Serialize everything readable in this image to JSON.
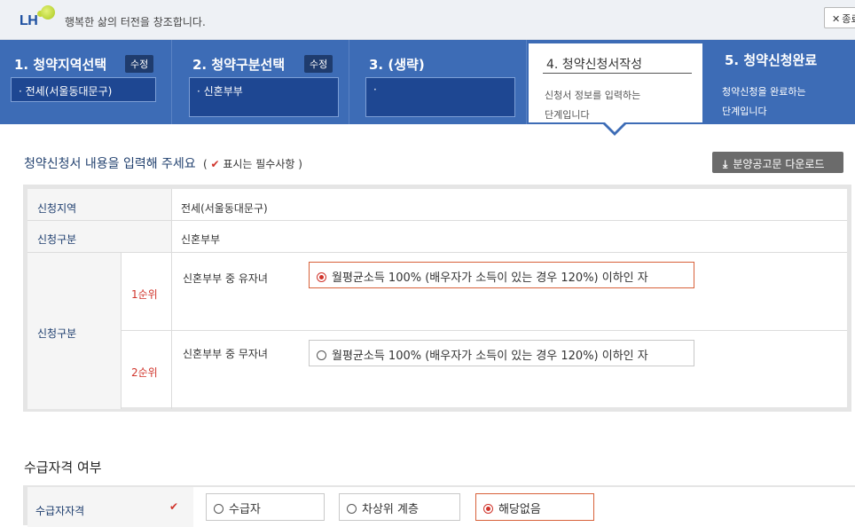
{
  "header": {
    "logo": "LH",
    "slogan": "행복한 삶의 터전을 창조합니다.",
    "close_label": "종료"
  },
  "steps": [
    {
      "title": "1. 청약지역선택",
      "edit": "수정",
      "value": "· 전세(서울동대문구)"
    },
    {
      "title": "2. 청약구분선택",
      "edit": "수정",
      "value": "· 신혼부부"
    },
    {
      "title": "3. (생략)",
      "value": "·"
    },
    {
      "title": "4. 청약신청서작성",
      "desc1": "신청서 정보를 입력하는",
      "desc2": "단계입니다"
    },
    {
      "title": "5. 청약신청완료",
      "desc1": "청약신청을 완료하는",
      "desc2": "단계입니다"
    }
  ],
  "form": {
    "heading": "청약신청서 내용을 입력해 주세요",
    "required_note": "표시는 필수사항",
    "download_label": "분양공고문 다운로드",
    "region_label": "신청지역",
    "region_value": "전세(서울동대문구)",
    "type_label": "신청구분",
    "type_value": "신혼부부",
    "type2_label": "신청구분",
    "rank1": "1순위",
    "rank1_desc": "신혼부부 중 유자녀",
    "rank1_option": "월평균소득 100% (배우자가 소득이 있는 경우 120%) 이하인 자",
    "rank2": "2순위",
    "rank2_desc": "신혼부부 중 무자녀",
    "rank2_option": "월평균소득 100% (배우자가 소득이 있는 경우 120%) 이하인 자"
  },
  "welfare": {
    "section_title": "수급자격 여부",
    "label": "수급자자격",
    "options": [
      "수급자",
      "차상위 계층",
      "해당없음"
    ],
    "selected": "해당없음"
  },
  "colors": {
    "brand_blue": "#3d6cb6",
    "required_red": "#d0342b",
    "selected_border": "#d8613a"
  }
}
